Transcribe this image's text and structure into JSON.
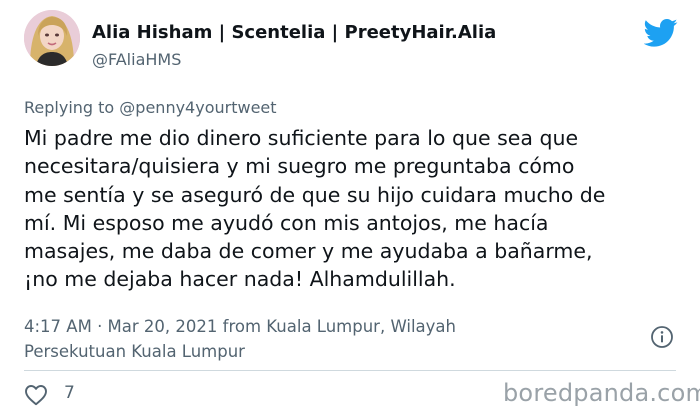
{
  "author": {
    "display_name": "Alia Hisham | Scentelia | PreetyHair.Alia",
    "handle": "@FAliaHMS"
  },
  "reply": {
    "prefix": "Replying to",
    "mention": "@penny4yourtweet"
  },
  "body_lines": [
    "Mi padre me dio dinero suficiente para lo que sea que",
    "necesitara/quisiera y mi suegro me preguntaba cómo",
    "me sentía y se aseguró de que su hijo cuidara mucho de",
    "mí. Mi esposo me ayudó con mis antojos, me hacía",
    "masajes, me daba de comer y me ayudaba a bañarme,",
    "¡no me dejaba hacer nada! Alhamdulillah."
  ],
  "meta_lines": [
    "4:17 AM · Mar 20, 2021 from Kuala Lumpur, Wilayah",
    "Persekutuan Kuala Lumpur"
  ],
  "like_count": "7",
  "watermark": "boredpanda.com",
  "icons": {
    "brand": "twitter-bird-icon",
    "info": "info-icon",
    "like": "heart-icon"
  },
  "colors": {
    "twitter_blue": "#1da1f2",
    "text": "#0f1419",
    "secondary": "#536471"
  }
}
